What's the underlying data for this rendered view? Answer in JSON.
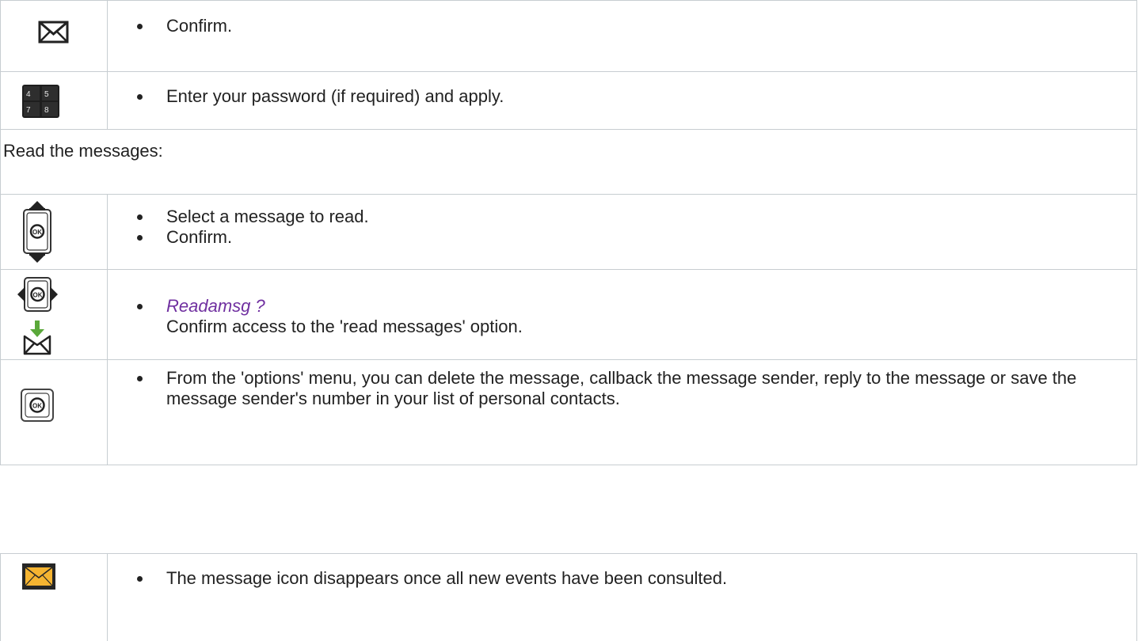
{
  "table1": {
    "row1": {
      "icon": "envelope-icon",
      "bullet": "Confirm."
    },
    "row2": {
      "icon": "keypad-icon",
      "bullet": "Enter your password (if required) and apply.",
      "keys": [
        "4",
        "5",
        "7",
        "8"
      ]
    },
    "header": "Read the messages:",
    "row3": {
      "icon": "nav-up-down-ok-icon",
      "bullets": [
        "Select a message to read.",
        "Confirm."
      ]
    },
    "row4": {
      "icons": [
        "nav-left-right-ok-icon",
        "read-message-icon"
      ],
      "italic": "Readamsg ?",
      "text": "Confirm access to the 'read messages' option."
    },
    "row5": {
      "icon": "ok-button-icon",
      "ok_label": "OK",
      "bullet": "From the 'options' menu, you can delete the message, callback the message sender, reply to the message or save the message sender's number in your list of personal contacts."
    }
  },
  "table2": {
    "row1": {
      "icon": "message-waiting-icon",
      "bullet": "The message icon disappears once all new events have been consulted."
    }
  },
  "colors": {
    "border": "#c7cdd1",
    "italic_text": "#7030a0",
    "arrow_green": "#5aa83a",
    "envelope_yellow": "#f5b431"
  }
}
